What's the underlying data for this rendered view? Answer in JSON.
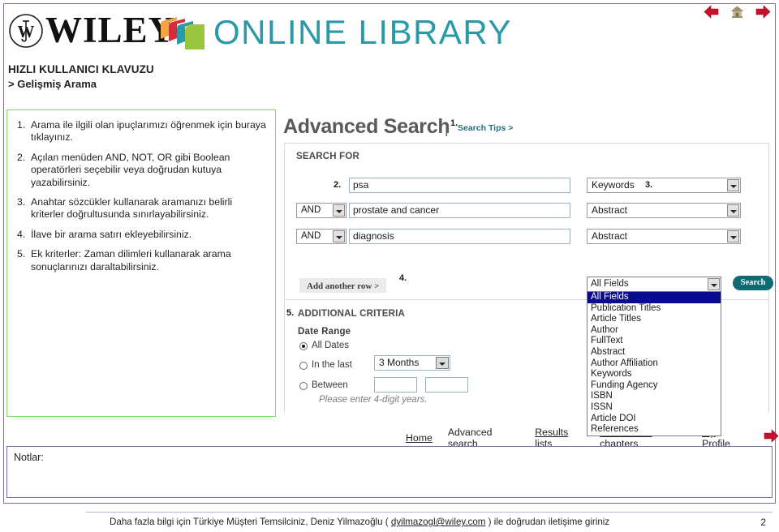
{
  "header": {
    "brand_wordmark": "WILEY",
    "brand_subword": "ONLINE LIBRARY",
    "nav_icons": [
      "back-arrow-icon",
      "home-icon",
      "forward-arrow-icon"
    ],
    "colors": {
      "teal": "#2a9aa8",
      "frame_purple": "#7d6bb0",
      "panel_green": "#7bd96b",
      "arrow_red": "#c8102e",
      "search_button": "#0d6b72",
      "option_selected": "#0a0a8c"
    }
  },
  "guide": {
    "title": "HIZLI KULLANICI KLAVUZU",
    "subtitle": "> Gelişmiş Arama"
  },
  "instructions": [
    {
      "num": "1.",
      "text": "Arama ile ilgili olan ipuçlarımızı öğrenmek için buraya tıklayınız."
    },
    {
      "num": "2.",
      "text": "Açılan menüden AND, NOT, OR gibi Boolean operatörleri seçebilir veya doğrudan kutuya yazabilirsiniz."
    },
    {
      "num": "3.",
      "text": "Anahtar sözcükler kullanarak aramanızı belirli kriterler doğrultusunda sınırlayabilirsiniz."
    },
    {
      "num": "4.",
      "text": "İlave bir arama satırı ekleyebilirsiniz."
    },
    {
      "num": "5.",
      "text": "Ek kriterler: Zaman dilimleri kullanarak arama sonuçlarınızı daraltabilirsiniz."
    }
  ],
  "screenshot": {
    "title": "Advanced Search",
    "title_pipe": "|",
    "tips_link": "Search Tips >",
    "search_for_label": "SEARCH FOR",
    "callouts": {
      "one": "1.",
      "two": "2.",
      "three": "3.",
      "four": "4.",
      "five": "5."
    },
    "rows": [
      {
        "operator": "",
        "query": "psa",
        "field": "Keywords"
      },
      {
        "operator": "AND",
        "query": "prostate and cancer",
        "field": "Abstract"
      },
      {
        "operator": "AND",
        "query": "diagnosis",
        "field": "Abstract"
      }
    ],
    "add_row_label": "Add another row >",
    "open_select_value": "All Fields",
    "field_options": [
      "All Fields",
      "Publication Titles",
      "Article Titles",
      "Author",
      "FullText",
      "Abstract",
      "Author Affiliation",
      "Keywords",
      "Funding Agency",
      "ISBN",
      "ISSN",
      "Article DOI",
      "References"
    ],
    "selected_option_index": 0,
    "search_button_label": "Search",
    "additional_criteria_label": "ADDITIONAL CRITERIA",
    "date_range_label": "Date Range",
    "radios": [
      {
        "label": "All Dates",
        "checked": true
      },
      {
        "label": "In the last",
        "checked": false
      },
      {
        "label": "Between",
        "checked": false
      }
    ],
    "months_value": "3 Months",
    "between_from": "",
    "between_to": "",
    "years_hint": "Please enter 4-digit years."
  },
  "bottom_nav": [
    {
      "label": "Home",
      "underline": true
    },
    {
      "label": "Advanced search",
      "underline": false
    },
    {
      "label": "Results lists",
      "underline": true
    },
    {
      "label": "Articles and chapters",
      "underline": true
    },
    {
      "label": "My Profile",
      "underline": true
    }
  ],
  "notes": {
    "label": "Notlar:"
  },
  "footer": {
    "text_before": "Daha fazla bilgi için Türkiye Müşteri Temsilciniz, Deniz Yilmazoğlu ( ",
    "email": "dyilmazogl@wiley.com",
    "text_after": " ) ile doğrudan iletişime giriniz",
    "page_number": "2"
  }
}
